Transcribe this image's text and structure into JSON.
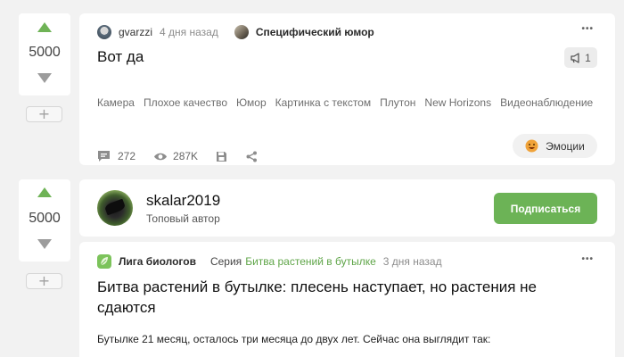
{
  "post1": {
    "rating": "5000",
    "author": "gvarzzi",
    "time": "4 дня назад",
    "community": "Специфический юмор",
    "title": "Вот да",
    "pin_count": "1",
    "tags": [
      "Камера",
      "Плохое качество",
      "Юмор",
      "Картинка с текстом",
      "Плутон",
      "New Horizons",
      "Видеонаблюдение"
    ],
    "comments": "272",
    "views": "287K",
    "emotions_label": "Эмоции",
    "more": "•••"
  },
  "post2": {
    "rating": "5000",
    "author": "skalar2019",
    "author_role": "Топовый автор",
    "follow_label": "Подписаться",
    "community": "Лига биологов",
    "series_label": "Серия",
    "series_name": "Битва растений в бутылке",
    "time": "3 дня назад",
    "title": "Битва растений в бутылке: плесень наступает, но растения не сдаются",
    "body": "Бутылке 21 месяц, осталось три месяца до двух лет. Сейчас она выглядит так:",
    "more": "•••"
  },
  "colors": {
    "accent_green": "#6cb356",
    "background": "#f2f2f2",
    "card": "#ffffff"
  },
  "icons": [
    "upvote-icon",
    "downvote-icon",
    "comment-icon",
    "eye-icon",
    "save-icon",
    "share-icon",
    "megaphone-icon",
    "emoji-icon"
  ]
}
